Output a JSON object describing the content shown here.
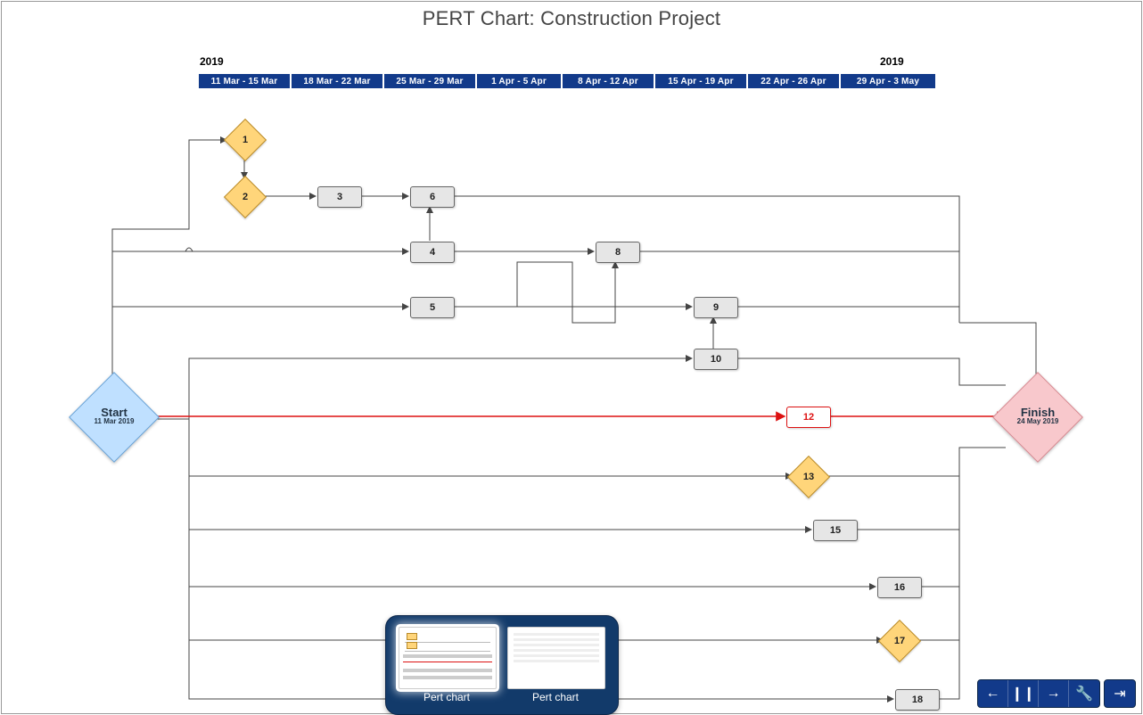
{
  "title": "PERT Chart: Construction Project",
  "timeline": {
    "year_left": "2019",
    "year_right": "2019",
    "weeks": [
      "11 Mar - 15 Mar",
      "18 Mar - 22 Mar",
      "25 Mar - 29 Mar",
      "1 Apr - 5 Apr",
      "8 Apr - 12 Apr",
      "15 Apr - 19 Apr",
      "22 Apr - 26 Apr",
      "29 Apr - 3 May"
    ]
  },
  "start_node": {
    "label": "Start",
    "date": "11 Mar 2019"
  },
  "finish_node": {
    "label": "Finish",
    "date": "24 May 2019"
  },
  "node_1": "1",
  "node_2": "2",
  "node_3": "3",
  "node_4": "4",
  "node_5": "5",
  "node_6": "6",
  "node_8": "8",
  "node_9": "9",
  "node_10": "10",
  "node_12": "12",
  "node_13": "13",
  "node_15": "15",
  "node_16": "16",
  "node_17": "17",
  "node_18": "18",
  "carousel": {
    "item1": "Pert chart",
    "item2": "Pert chart"
  },
  "chart_data": {
    "type": "pert",
    "timeline_weeks": [
      "11 Mar - 15 Mar",
      "18 Mar - 22 Mar",
      "25 Mar - 29 Mar",
      "1 Apr - 5 Apr",
      "8 Apr - 12 Apr",
      "15 Apr - 19 Apr",
      "22 Apr - 26 Apr",
      "29 Apr - 3 May"
    ],
    "nodes": [
      {
        "id": "start",
        "type": "milestone",
        "label": "Start",
        "date": "11 Mar 2019"
      },
      {
        "id": "1",
        "type": "decision",
        "week": 1
      },
      {
        "id": "2",
        "type": "decision",
        "week": 1
      },
      {
        "id": "3",
        "type": "task",
        "week": 2
      },
      {
        "id": "4",
        "type": "task",
        "week": 3
      },
      {
        "id": "5",
        "type": "task",
        "week": 3
      },
      {
        "id": "6",
        "type": "task",
        "week": 3
      },
      {
        "id": "8",
        "type": "task",
        "week": 5
      },
      {
        "id": "9",
        "type": "task",
        "week": 6
      },
      {
        "id": "10",
        "type": "task",
        "week": 6
      },
      {
        "id": "12",
        "type": "task",
        "week": 7,
        "critical": true
      },
      {
        "id": "13",
        "type": "decision",
        "week": 7
      },
      {
        "id": "15",
        "type": "task",
        "week": 8
      },
      {
        "id": "16",
        "type": "task",
        "week": 8
      },
      {
        "id": "17",
        "type": "decision",
        "week": 8
      },
      {
        "id": "18",
        "type": "task",
        "week": 8
      },
      {
        "id": "finish",
        "type": "milestone",
        "label": "Finish",
        "date": "24 May 2019"
      }
    ],
    "edges": [
      {
        "from": "start",
        "to": "1"
      },
      {
        "from": "1",
        "to": "2"
      },
      {
        "from": "2",
        "to": "3"
      },
      {
        "from": "start",
        "to": "4"
      },
      {
        "from": "start",
        "to": "5"
      },
      {
        "from": "3",
        "to": "6"
      },
      {
        "from": "4",
        "to": "6"
      },
      {
        "from": "4",
        "to": "8"
      },
      {
        "from": "5",
        "to": "8"
      },
      {
        "from": "5",
        "to": "9"
      },
      {
        "from": "start",
        "to": "10"
      },
      {
        "from": "start",
        "to": "12",
        "critical": true
      },
      {
        "from": "12",
        "to": "finish",
        "critical": true
      },
      {
        "from": "start",
        "to": "13"
      },
      {
        "from": "start",
        "to": "15"
      },
      {
        "from": "start",
        "to": "16"
      },
      {
        "from": "start",
        "to": "17"
      },
      {
        "from": "start",
        "to": "18"
      },
      {
        "from": "6",
        "to": "finish"
      },
      {
        "from": "8",
        "to": "finish"
      },
      {
        "from": "9",
        "to": "finish"
      },
      {
        "from": "10",
        "to": "finish"
      },
      {
        "from": "13",
        "to": "finish"
      },
      {
        "from": "15",
        "to": "finish"
      },
      {
        "from": "16",
        "to": "finish"
      },
      {
        "from": "17",
        "to": "finish"
      },
      {
        "from": "18",
        "to": "finish"
      }
    ],
    "critical_path": [
      "start",
      "12",
      "finish"
    ]
  }
}
